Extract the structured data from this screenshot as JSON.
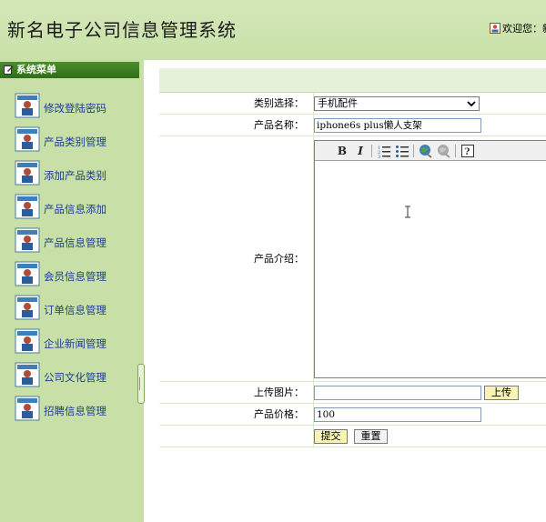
{
  "header": {
    "title": "新名电子公司信息管理系统",
    "welcome": "欢迎您：新"
  },
  "sidebar": {
    "title": "系统菜单",
    "items": [
      {
        "label": "修改登陆密码"
      },
      {
        "label": "产品类别管理"
      },
      {
        "label": "添加产品类别"
      },
      {
        "label": "产品信息添加"
      },
      {
        "label": "产品信息管理"
      },
      {
        "label": "会员信息管理"
      },
      {
        "label": "订单信息管理"
      },
      {
        "label": "企业新闻管理"
      },
      {
        "label": "公司文化管理"
      },
      {
        "label": "招聘信息管理"
      }
    ]
  },
  "form": {
    "category_label": "类别选择：",
    "category_value": "手机配件",
    "name_label": "产品名称：",
    "name_value": "iphone6s plus懒人支架",
    "intro_label": "产品介绍：",
    "image_label": "上传图片：",
    "image_value": "",
    "upload_button": "上传",
    "price_label": "产品价格：",
    "price_value": "100",
    "submit_button": "提交",
    "reset_button": "重置"
  },
  "editor": {
    "toolbar": [
      "bold-icon",
      "italic-icon",
      "numbered-list-icon",
      "bullet-list-icon",
      "globe-link-icon",
      "unlink-icon",
      "help-icon"
    ]
  },
  "colors": {
    "header_bg": "#c9e1a8",
    "sidebar_bg": "#c8e0a8",
    "sidebar_header_bg": "#2f6e17",
    "menu_link": "#1e3d8f",
    "button_yellow": "#f8f3b6"
  }
}
